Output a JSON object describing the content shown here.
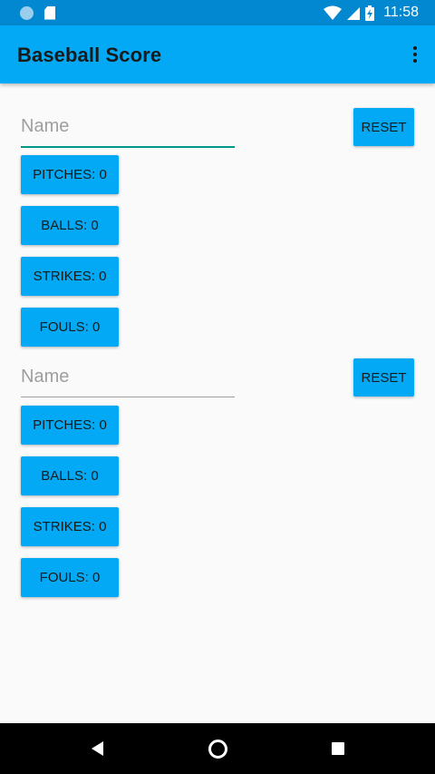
{
  "status_bar": {
    "time": "11:58",
    "icons": [
      "circle-icon",
      "sd-card-icon",
      "wifi-icon",
      "signal-icon",
      "battery-charging-icon"
    ]
  },
  "app_bar": {
    "title": "Baseball Score",
    "menu_icon": "overflow-menu-icon"
  },
  "players": [
    {
      "name_placeholder": "Name",
      "name_value": "",
      "reset_label": "RESET",
      "pitches_label": "PITCHES: 0",
      "balls_label": "BALLS: 0",
      "strikes_label": "STRIKES: 0",
      "fouls_label": "FOULS: 0"
    },
    {
      "name_placeholder": "Name",
      "name_value": "",
      "reset_label": "RESET",
      "pitches_label": "PITCHES: 0",
      "balls_label": "BALLS: 0",
      "strikes_label": "STRIKES: 0",
      "fouls_label": "FOULS: 0"
    }
  ],
  "nav_bar": {
    "icons": [
      "back-icon",
      "home-icon",
      "recents-icon"
    ]
  },
  "colors": {
    "status_bar": "#0288d1",
    "app_bar": "#03a9f4",
    "button": "#03a9f4",
    "focused_underline": "#009688",
    "background": "#fafafa"
  }
}
